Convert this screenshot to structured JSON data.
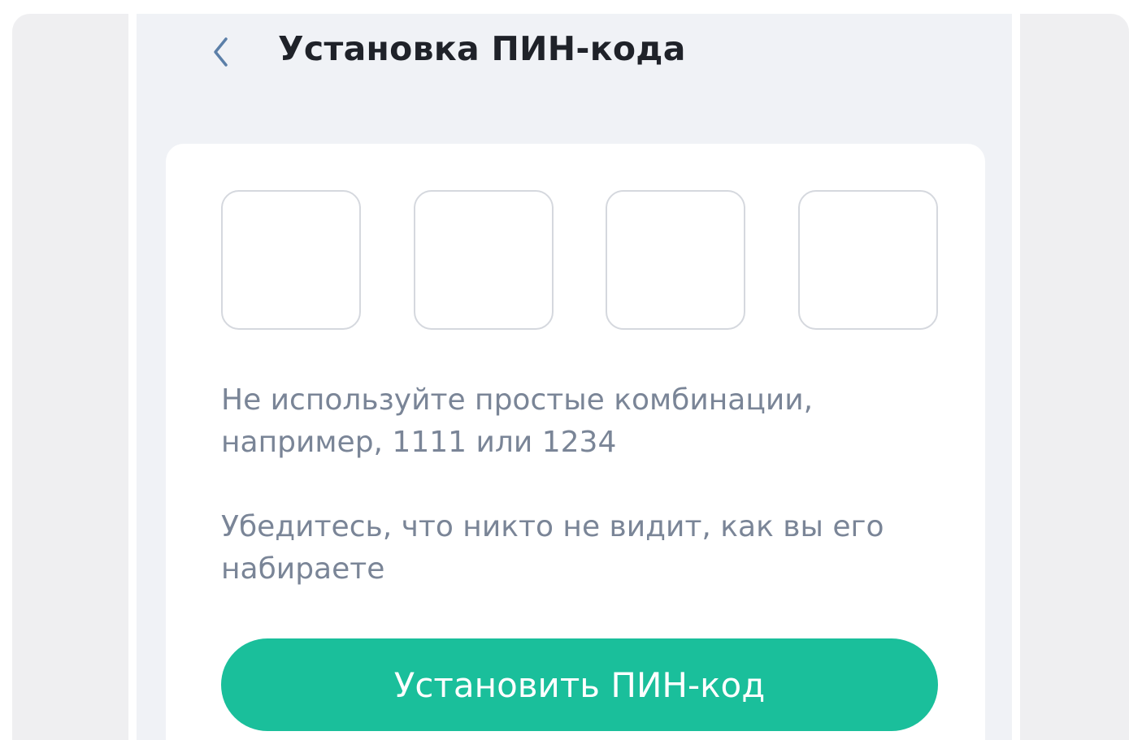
{
  "header": {
    "back_icon": "chevron-left-icon",
    "title": "Установка ПИН-кода"
  },
  "pin": {
    "digits": [
      "",
      "",
      "",
      ""
    ]
  },
  "hints": {
    "simple_combinations": "Не используйте простые комбинации, например, 1111 или 1234",
    "privacy": "Убедитесь, что никто не видит, как вы его набираете"
  },
  "actions": {
    "submit_label": "Установить ПИН-код"
  },
  "colors": {
    "accent": "#1abf9b",
    "background": "#f0f2f6",
    "title_text": "#1f2229",
    "hint_text": "#7a8597",
    "back_icon": "#5b7fa8",
    "pin_border": "#d5d8de"
  }
}
